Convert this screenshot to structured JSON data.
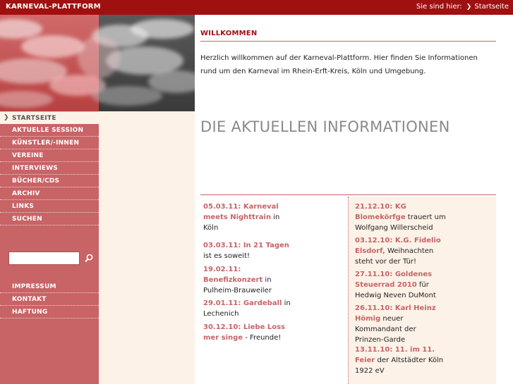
{
  "header": {
    "brand": "KARNEVAL-PLATTFORM",
    "breadcrumb_label": "Sie sind hier:",
    "breadcrumb_arrow": "❯",
    "breadcrumb_link": "Startseite"
  },
  "sidebar": {
    "current_arrow": "❯",
    "current": "STARTSEITE",
    "items": [
      {
        "label": "AKTUELLE SESSION"
      },
      {
        "label": "KÜNSTLER/-INNEN"
      },
      {
        "label": "VEREINE"
      },
      {
        "label": "INTERVIEWS"
      },
      {
        "label": "BÜCHER/CDS"
      },
      {
        "label": "ARCHIV"
      },
      {
        "label": "LINKS"
      },
      {
        "label": "SUCHEN"
      }
    ],
    "search": {
      "value": "",
      "placeholder": ""
    },
    "footer_items": [
      {
        "label": "IMPRESSUM"
      },
      {
        "label": "KONTAKT"
      },
      {
        "label": "HAFTUNG"
      }
    ]
  },
  "main": {
    "welcome_title": "WILLKOMMEN",
    "welcome_text": "Herzlich willkommen auf der Karneval-Plattform. Hier finden Sie Informationen rund um den Karneval im Rhein-Erft-Kreis, Köln und Umgebung.",
    "news_title": "DIE AKTUELLEN INFORMATIONEN",
    "news_left": [
      {
        "head": "05.03.11: Karneval meets Nighttrain",
        "rest": " in Köln"
      },
      {
        "head": "03.03.11: In 21 Tagen",
        "rest": " ist es soweit!"
      },
      {
        "head": "19.02.11: Benefizkonzert",
        "rest": " in Pulheim-Brauweiler"
      },
      {
        "head": "29.01.11: Gardeball",
        "rest": " in Lechenich"
      },
      {
        "head": "30.12.10: Liebe Loss mer singe",
        "rest": " - Freunde!"
      }
    ],
    "news_right": [
      {
        "head": "21.12.10: KG Blomekörfge",
        "rest": " trauert um Wolfgang Willerscheid"
      },
      {
        "head": "03.12.10: K.G. Fidelio Elsdorf,",
        "rest": " Weihnachten steht vor der Tür!"
      },
      {
        "head": "27.11.10: Goldenes Steuerrad 2010",
        "rest": " für Hedwig Neven DuMont"
      },
      {
        "head": "26.11.10: Karl Heinz Hömig",
        "rest": " neuer Kommandant der Prinzen-Garde"
      },
      {
        "head": "13.11.10: 11. im 11. Feier",
        "rest": " der Altstädter Köln 1922 eV"
      }
    ]
  },
  "colors": {
    "brand_red": "#a01010",
    "nav_pink": "#c86366",
    "cream": "#fdf2e8",
    "headline_gray": "#8a8a8a"
  },
  "icons": {
    "search": "magnifier-icon",
    "breadcrumb": "chevron-right-icon"
  }
}
